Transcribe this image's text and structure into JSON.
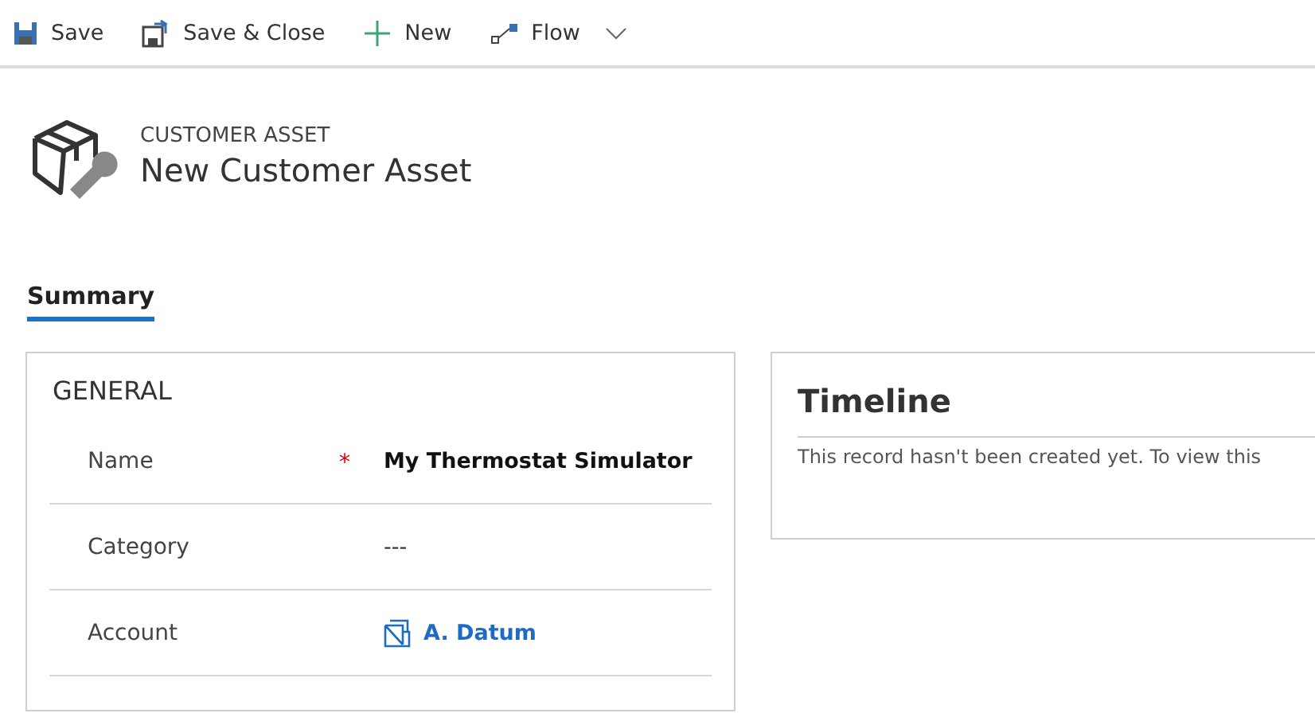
{
  "toolbar": [
    {
      "kind": "save",
      "label": "Save"
    },
    {
      "kind": "save-close",
      "label": "Save & Close"
    },
    {
      "kind": "new",
      "label": "New"
    },
    {
      "kind": "flow",
      "label": "Flow",
      "menu": true
    }
  ],
  "header": {
    "entity": "CUSTOMER ASSET",
    "title": "New Customer Asset"
  },
  "tabs": [
    {
      "label": "Summary",
      "selected": true
    }
  ],
  "general": {
    "title": "GENERAL",
    "fields": [
      {
        "label": "Name",
        "required_mark": "*",
        "kind": "text",
        "value": "My Thermostat Simulator"
      },
      {
        "label": "Category",
        "kind": "empty",
        "value": "---"
      },
      {
        "label": "Account",
        "kind": "lookup",
        "value": "A. Datum"
      }
    ]
  },
  "timeline": {
    "title": "Timeline",
    "message": "This record hasn't been created yet.  To view this"
  }
}
